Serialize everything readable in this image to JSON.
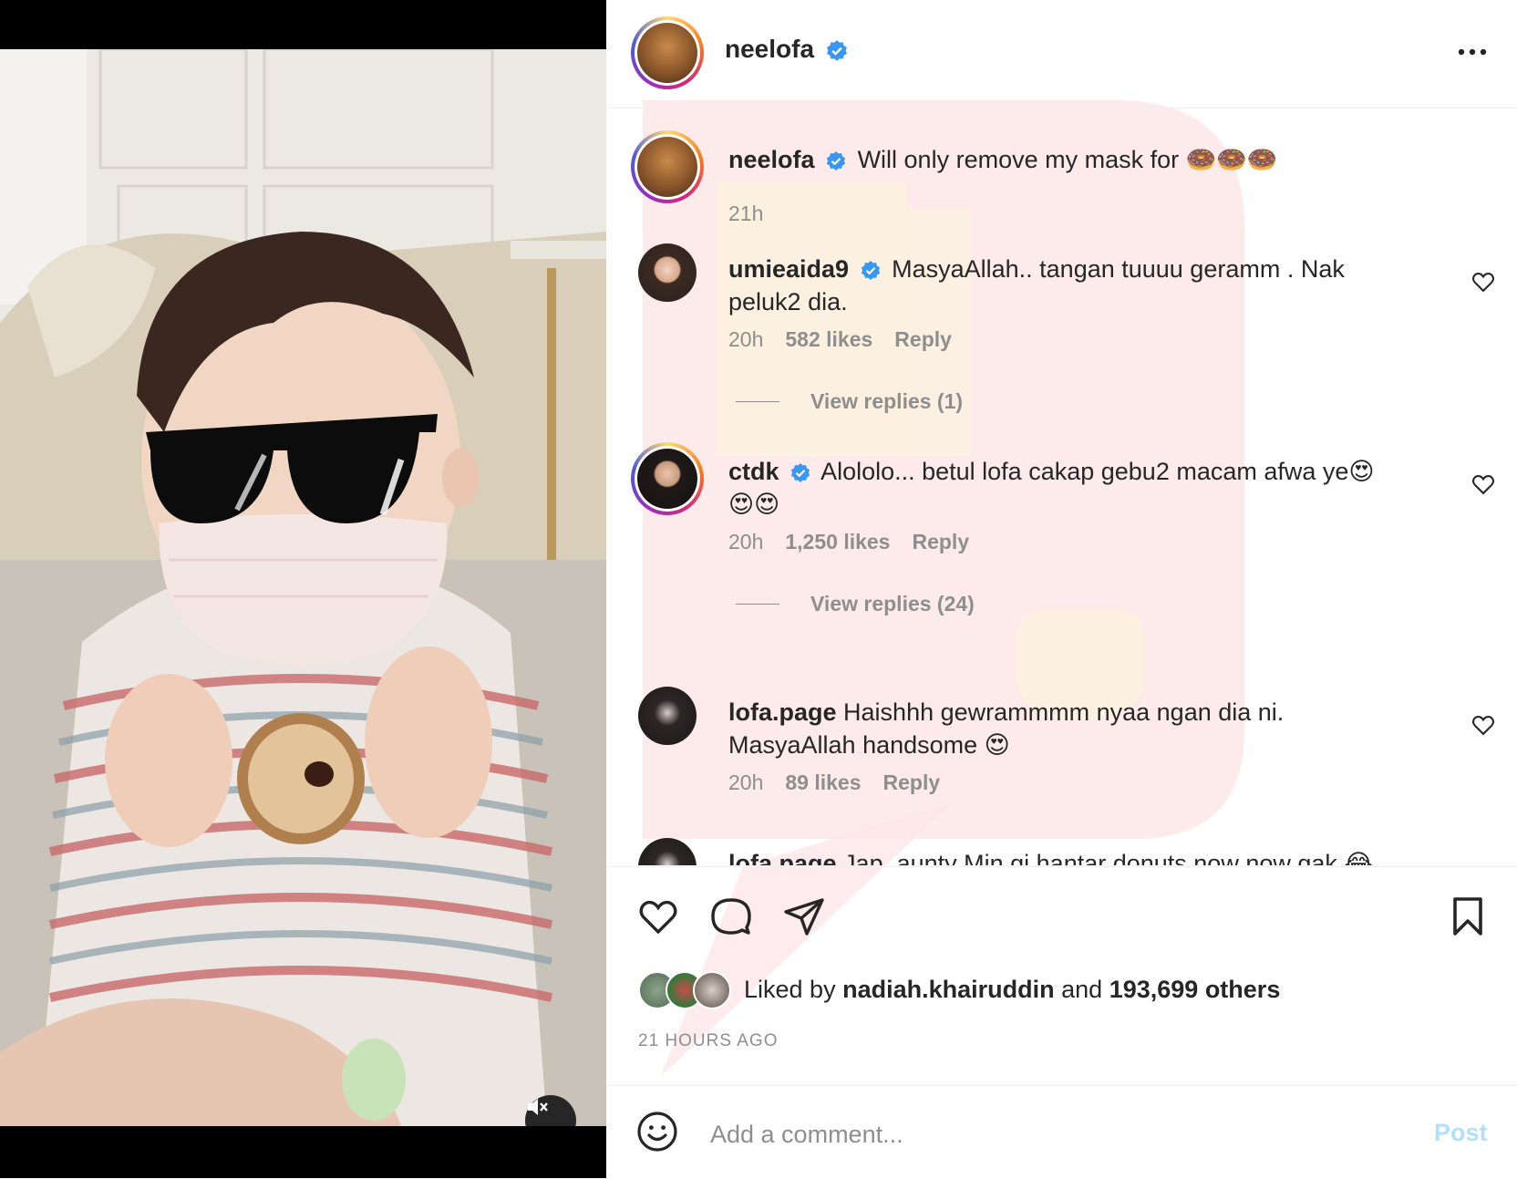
{
  "post": {
    "username": "neelofa",
    "caption": "Will only remove my mask for 🍩🍩🍩",
    "caption_time": "21h"
  },
  "comments": [
    {
      "username": "umieaida9",
      "verified": true,
      "text": "MasyaAllah.. tangan tuuuu geramm . Nak peluk2 dia.",
      "time": "20h",
      "likes": "582 likes",
      "reply": "Reply",
      "view_replies": "View replies (1)"
    },
    {
      "username": "ctdk",
      "verified": true,
      "text": "Alololo... betul lofa cakap gebu2 macam afwa ye😍😍😍",
      "time": "20h",
      "likes": "1,250 likes",
      "reply": "Reply",
      "view_replies": "View replies (24)"
    },
    {
      "username": "lofa.page",
      "verified": false,
      "text": "Haishhh gewrammmm nyaa ngan dia ni. MasyaAllah handsome 😍",
      "time": "20h",
      "likes": "89 likes",
      "reply": "Reply"
    },
    {
      "username": "lofa.page",
      "verified": false,
      "text": "Jap, aunty Min gi hantar donuts now now gak 😂"
    }
  ],
  "likes": {
    "prefix": "Liked by",
    "user": "nadiah.khairuddin",
    "middle": "and",
    "others": "193,699 others"
  },
  "timestamp": "21 HOURS AGO",
  "add_comment": {
    "placeholder": "Add a comment...",
    "post_label": "Post"
  },
  "icons": [
    "verified-icon",
    "more-icon",
    "heart-icon",
    "comment-icon",
    "share-icon",
    "bookmark-icon",
    "emoji-icon",
    "mute-icon"
  ],
  "colors": {
    "verified": "#3897f0",
    "link_disabled": "#b2dffc",
    "meta": "#8e8e8e"
  }
}
